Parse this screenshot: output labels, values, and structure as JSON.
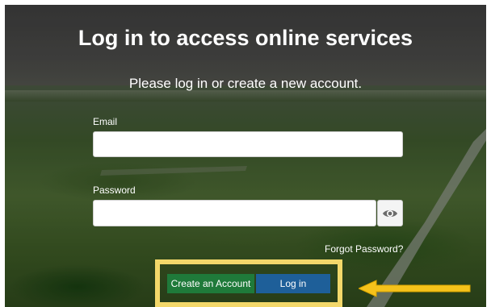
{
  "page": {
    "title": "Log in to access online services",
    "subtitle": "Please log in or create a new account."
  },
  "form": {
    "email_label": "Email",
    "email_value": "",
    "password_label": "Password",
    "password_value": "",
    "forgot_password": "Forgot Password?",
    "create_account_label": "Create an Account",
    "login_label": "Log in"
  },
  "icons": {
    "password_toggle": "eye-icon",
    "annotation": "arrow-left-icon"
  },
  "colors": {
    "create_button": "#1f7a3a",
    "login_button": "#1e5f99",
    "highlight": "#f3d86a",
    "annotation_arrow": "#f5c21b"
  }
}
